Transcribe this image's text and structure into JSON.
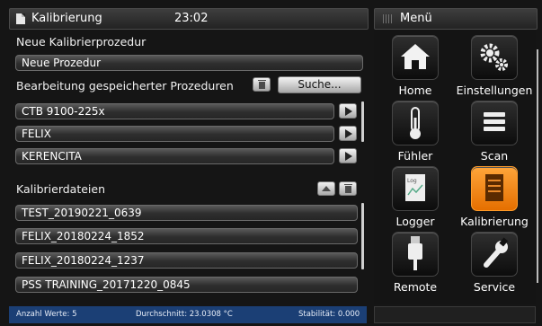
{
  "window": {
    "title": "Kalibrierung",
    "time": "23:02",
    "menu_title": "Menü"
  },
  "new_procedure": {
    "label": "Neue Kalibrierprozedur",
    "value": "Neue Prozedur"
  },
  "edit_saved": {
    "label": "Bearbeitung gespeicherter Prozeduren",
    "search_label": "Suche..."
  },
  "procedures": [
    {
      "name": "CTB 9100-225x"
    },
    {
      "name": "FELIX"
    },
    {
      "name": "KERENCITA"
    }
  ],
  "calibration_files": {
    "label": "Kalibrierdateien",
    "files": [
      {
        "name": "TEST_20190221_0639"
      },
      {
        "name": "FELIX_20180224_1852"
      },
      {
        "name": "FELIX_20180224_1237"
      },
      {
        "name": "PSS TRAINING_20171220_0845"
      }
    ]
  },
  "status": {
    "count": "Anzahl Werte: 5",
    "average": "Durchschnitt: 23.0308 °C",
    "stability": "Stabilität: 0.000",
    "color": "#1b3f75"
  },
  "menu": {
    "accent": "#f28a12",
    "items": [
      {
        "label": "Home",
        "icon": "house-icon",
        "active": false
      },
      {
        "label": "Einstellungen",
        "icon": "gears-icon",
        "active": false
      },
      {
        "label": "Fühler",
        "icon": "thermometer-icon",
        "active": false
      },
      {
        "label": "Scan",
        "icon": "stack-icon",
        "active": false
      },
      {
        "label": "Logger",
        "icon": "logger-icon",
        "active": false
      },
      {
        "label": "Kalibrierung",
        "icon": "calibration-icon",
        "active": true
      },
      {
        "label": "Remote",
        "icon": "usb-icon",
        "active": false
      },
      {
        "label": "Service",
        "icon": "wrench-icon",
        "active": false
      }
    ]
  }
}
